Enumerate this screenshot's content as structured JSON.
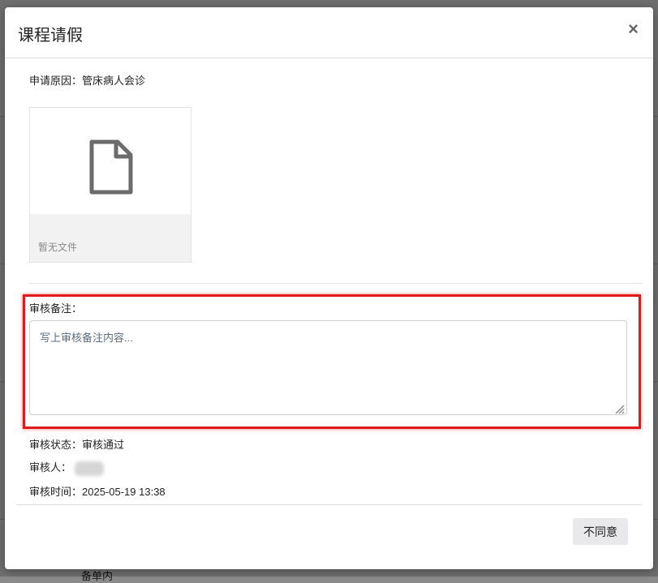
{
  "modal": {
    "title": "课程请假",
    "close_symbol": "×",
    "reason_label": "申请原因：",
    "reason_value": "管床病人会诊",
    "attachment": {
      "icon": "file-icon",
      "empty_text": "暂无文件"
    },
    "remark": {
      "label": "审核备注：",
      "placeholder": "写上审核备注内容..."
    },
    "status_label": "审核状态：",
    "status_value": "审核通过",
    "reviewer_label": "审核人：",
    "time_label": "审核时间：",
    "time_value": "2025-05-19 13:38",
    "reject_button": "不同意"
  },
  "background": {
    "bottom_text": "备单内"
  },
  "colors": {
    "highlight": "#e0191b",
    "overlay": "rgba(0,0,0,0.5)",
    "button_bg": "#e9e9ec"
  }
}
